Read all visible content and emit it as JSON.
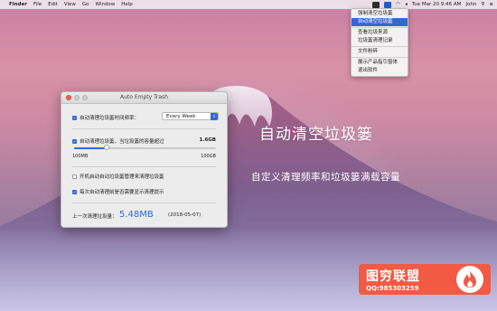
{
  "menubar": {
    "apple_glyph": "",
    "items": [
      "Finder",
      "File",
      "Edit",
      "View",
      "Go",
      "Window",
      "Help"
    ],
    "clock": "Tue Mar 20 9:46 AM",
    "user": "John"
  },
  "dropdown": {
    "items": [
      "强制清空垃圾篓",
      "自动清空垃圾篓",
      "查看垃圾来源",
      "垃圾篓清理记录",
      "文件粉碎",
      "展示产品指引窗体",
      "退出软件"
    ],
    "selected_index": 1
  },
  "hero": {
    "title": "自动清空垃圾篓",
    "subtitle": "自定义清理频率和垃圾篓满载容量"
  },
  "window": {
    "title": "Auto Empty Trash",
    "frequency_label": "自动清理垃圾篓时间频率：",
    "frequency_value": "Every Week",
    "capacity_label": "自动清理垃圾篓，当垃圾篓的容量超过",
    "capacity_value": "1.6GB",
    "slider_min": "100MB",
    "slider_max": "100GB",
    "slider_fraction": 0.23,
    "startup_label": "开机启动自动垃圾篓管理来清理垃圾篓",
    "startup_checked": false,
    "prompt_label": "每次自动清理前是否需要显示清理提示",
    "prompt_checked": true,
    "frequency_checked": true,
    "capacity_checked": true,
    "last_label": "上一次清理垃圾量：",
    "last_size": "5.48MB",
    "last_date": "(2018-05-07)"
  },
  "watermark": {
    "title": "图穷联盟",
    "qq": "QQ:985303259"
  },
  "colors": {
    "accent": "#2f6ad9",
    "watermark": "#f25a43"
  }
}
